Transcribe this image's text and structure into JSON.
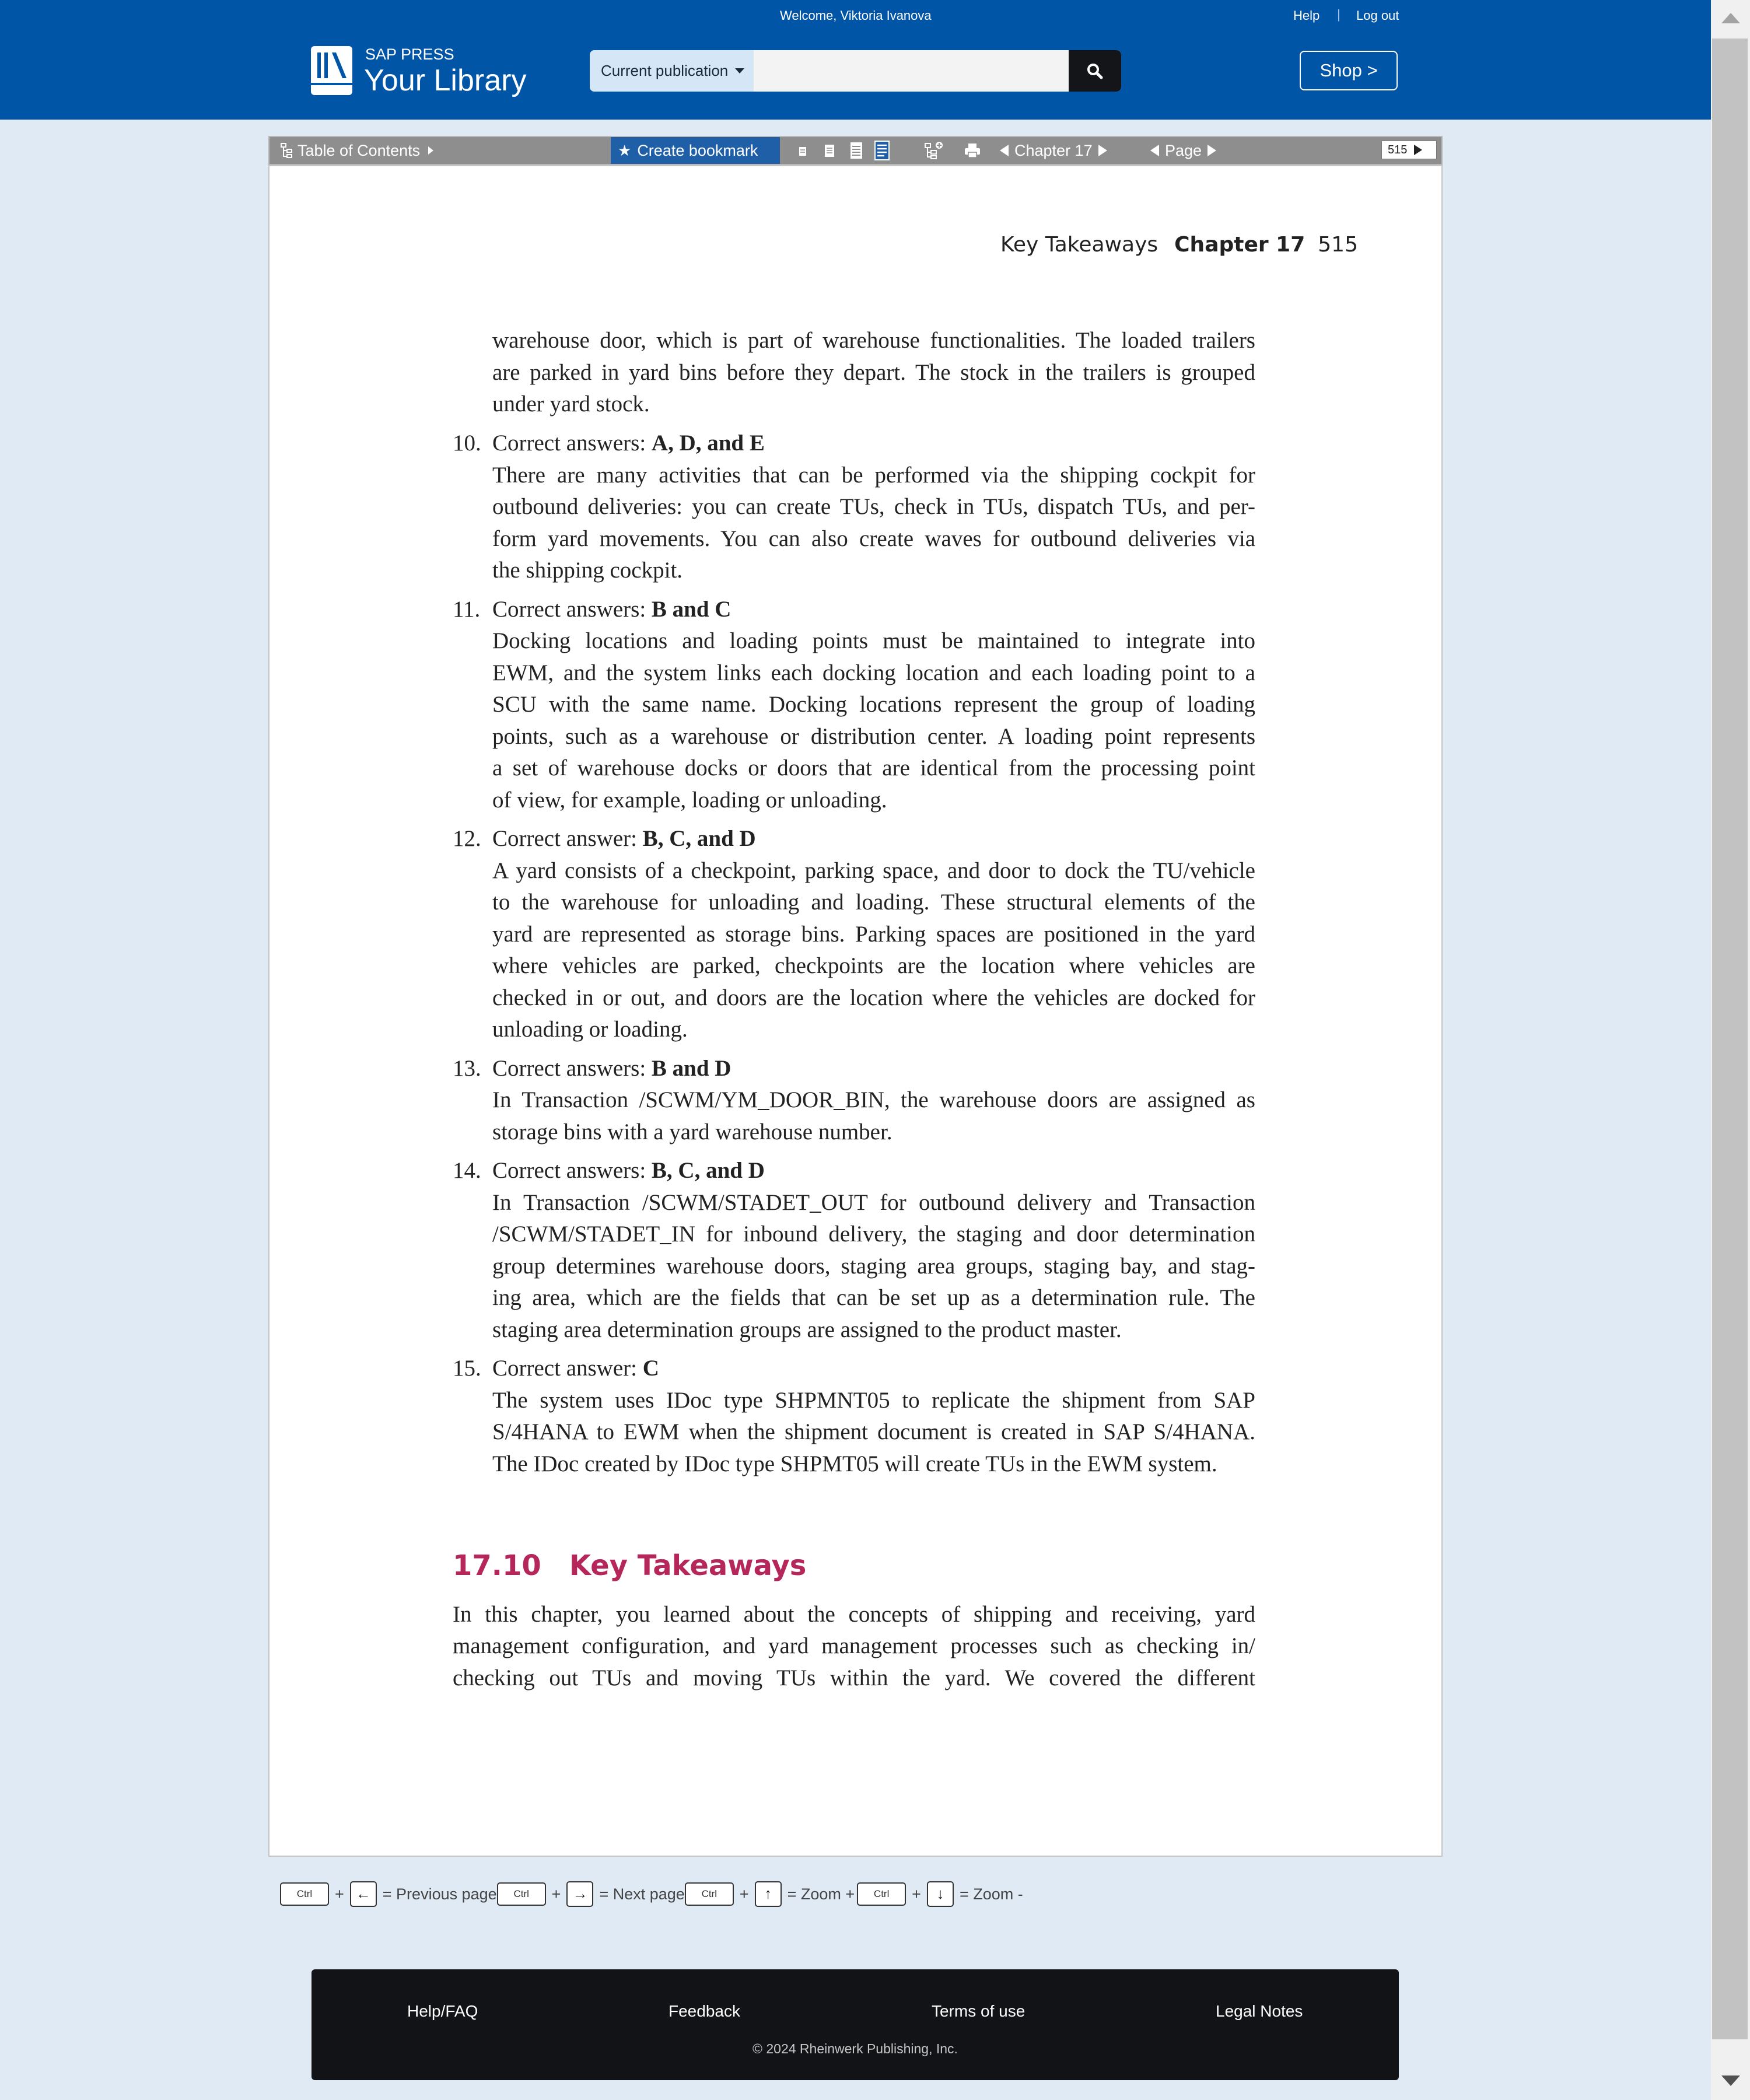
{
  "header": {
    "welcome": "Welcome, Viktoria Ivanova",
    "help": "Help",
    "logout": "Log out",
    "brand_small": "SAP PRESS",
    "brand_big": "Your Library",
    "search_scope": "Current publication",
    "search_value": "",
    "shop": "Shop >"
  },
  "toolbar": {
    "toc": "Table of Contents",
    "bookmark": "Create bookmark",
    "chapter": "Chapter 17",
    "page": "Page",
    "page_number": "515"
  },
  "document": {
    "running_head": {
      "section": "Key Takeaways",
      "chapter": "Chapter 17",
      "page": "515"
    },
    "lines": [
      "warehouse door, which is part of warehouse functionalities. The loaded trailers",
      "are parked in yard bins before they depart. The stock in the trailers is grouped",
      "under yard stock.",
      "There are many activities that can be performed via the shipping cockpit for",
      "outbound deliveries: you can create TUs, check in TUs, dispatch TUs, and per-",
      "form yard movements. You can also create waves for outbound deliveries via",
      "the shipping cockpit.",
      "Docking locations and loading points must be maintained to integrate into",
      "EWM, and the system links each docking location and each loading point to a",
      "SCU with the same name. Docking locations represent the group of loading",
      "points, such as a warehouse or distribution center. A loading point represents",
      "a set of warehouse docks or doors that are identical from the processing point",
      "of view, for example, loading or unloading.",
      "A yard consists of a checkpoint, parking space, and door to dock the TU/vehicle",
      "to the warehouse for unloading and loading. These structural elements of the",
      "yard are represented as storage bins. Parking spaces are positioned in the yard",
      "where vehicles are parked, checkpoints are the location where vehicles are",
      "checked in or out, and doors are the location where the vehicles are docked for",
      "unloading or loading.",
      "In Transaction /SCWM/YM_DOOR_BIN, the warehouse doors are assigned as",
      "storage bins with a yard warehouse number.",
      "In Transaction /SCWM/STADET_OUT for outbound delivery and Transaction",
      "/SCWM/STADET_IN for inbound delivery, the staging and door determination",
      "group determines warehouse doors, staging area groups, staging bay, and stag-",
      "ing area, which are the fields that can be set up as a determination rule. The",
      "staging area determination groups are assigned to the product master.",
      "The system uses IDoc type SHPMNT05 to replicate the shipment from SAP",
      "S/4HANA to EWM when the shipment document is created in SAP S/4HANA.",
      "The IDoc created by IDoc type SHPMT05 will create TUs in the EWM system.",
      "In this chapter, you learned about the concepts of shipping and receiving, yard",
      "management configuration, and yard management processes such as checking in/",
      "checking out TUs and moving TUs within the yard. We covered the different"
    ],
    "answers": [
      {
        "num": "10.",
        "label": "Correct answers: ",
        "value": "A, D, and E"
      },
      {
        "num": "11.",
        "label": "Correct answers: ",
        "value": "B and C"
      },
      {
        "num": "12.",
        "label": "Correct answer: ",
        "value": "B, C, and D"
      },
      {
        "num": "13.",
        "label": "Correct answers: ",
        "value": "B and D"
      },
      {
        "num": "14.",
        "label": "Correct answers: ",
        "value": "B, C, and D"
      },
      {
        "num": "15.",
        "label": "Correct answer: ",
        "value": "C"
      }
    ],
    "section": {
      "number": "17.10",
      "title": "Key Takeaways"
    }
  },
  "shortcuts": {
    "ctrl": "Ctrl",
    "plus": "+",
    "prev": "= Previous page",
    "next": "= Next page",
    "zoom_in": "= Zoom +",
    "zoom_out": "= Zoom -"
  },
  "footer": {
    "help": "Help/FAQ",
    "feedback": "Feedback",
    "terms": "Terms of use",
    "legal": "Legal Notes",
    "copyright": "© 2024 Rheinwerk Publishing, Inc."
  }
}
